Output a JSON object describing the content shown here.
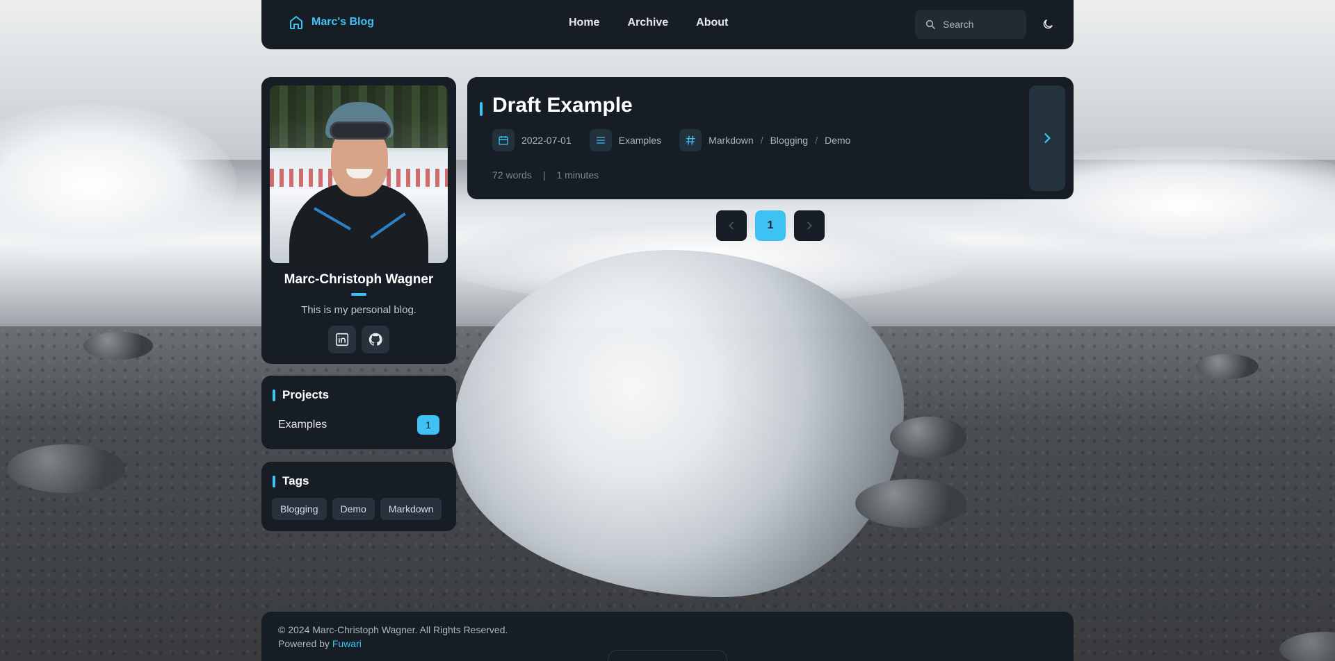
{
  "site": {
    "brand": "Marc's Blog"
  },
  "nav": {
    "items": [
      "Home",
      "Archive",
      "About"
    ]
  },
  "search": {
    "placeholder": "Search"
  },
  "profile": {
    "name": "Marc-Christoph Wagner",
    "bio": "This is my personal blog.",
    "socials": [
      "linkedin-icon",
      "github-icon"
    ]
  },
  "projects": {
    "title": "Projects",
    "items": [
      {
        "label": "Examples",
        "count": "1"
      }
    ]
  },
  "tags": {
    "title": "Tags",
    "items": [
      "Blogging",
      "Demo",
      "Markdown"
    ]
  },
  "post": {
    "title": "Draft Example",
    "date": "2022-07-01",
    "category": "Examples",
    "tags": [
      "Markdown",
      "Blogging",
      "Demo"
    ],
    "tag_separator": "/",
    "words": "72 words",
    "divider": "|",
    "reading_time": "1 minutes"
  },
  "pagination": {
    "current": "1"
  },
  "footer": {
    "copyright": "© 2024 Marc-Christoph Wagner. All Rights Reserved.",
    "powered_prefix": "Powered by",
    "powered_link": "Fuwari"
  },
  "colors": {
    "accent": "#3ec1f3",
    "card": "#171d24",
    "chip": "#27323d"
  }
}
